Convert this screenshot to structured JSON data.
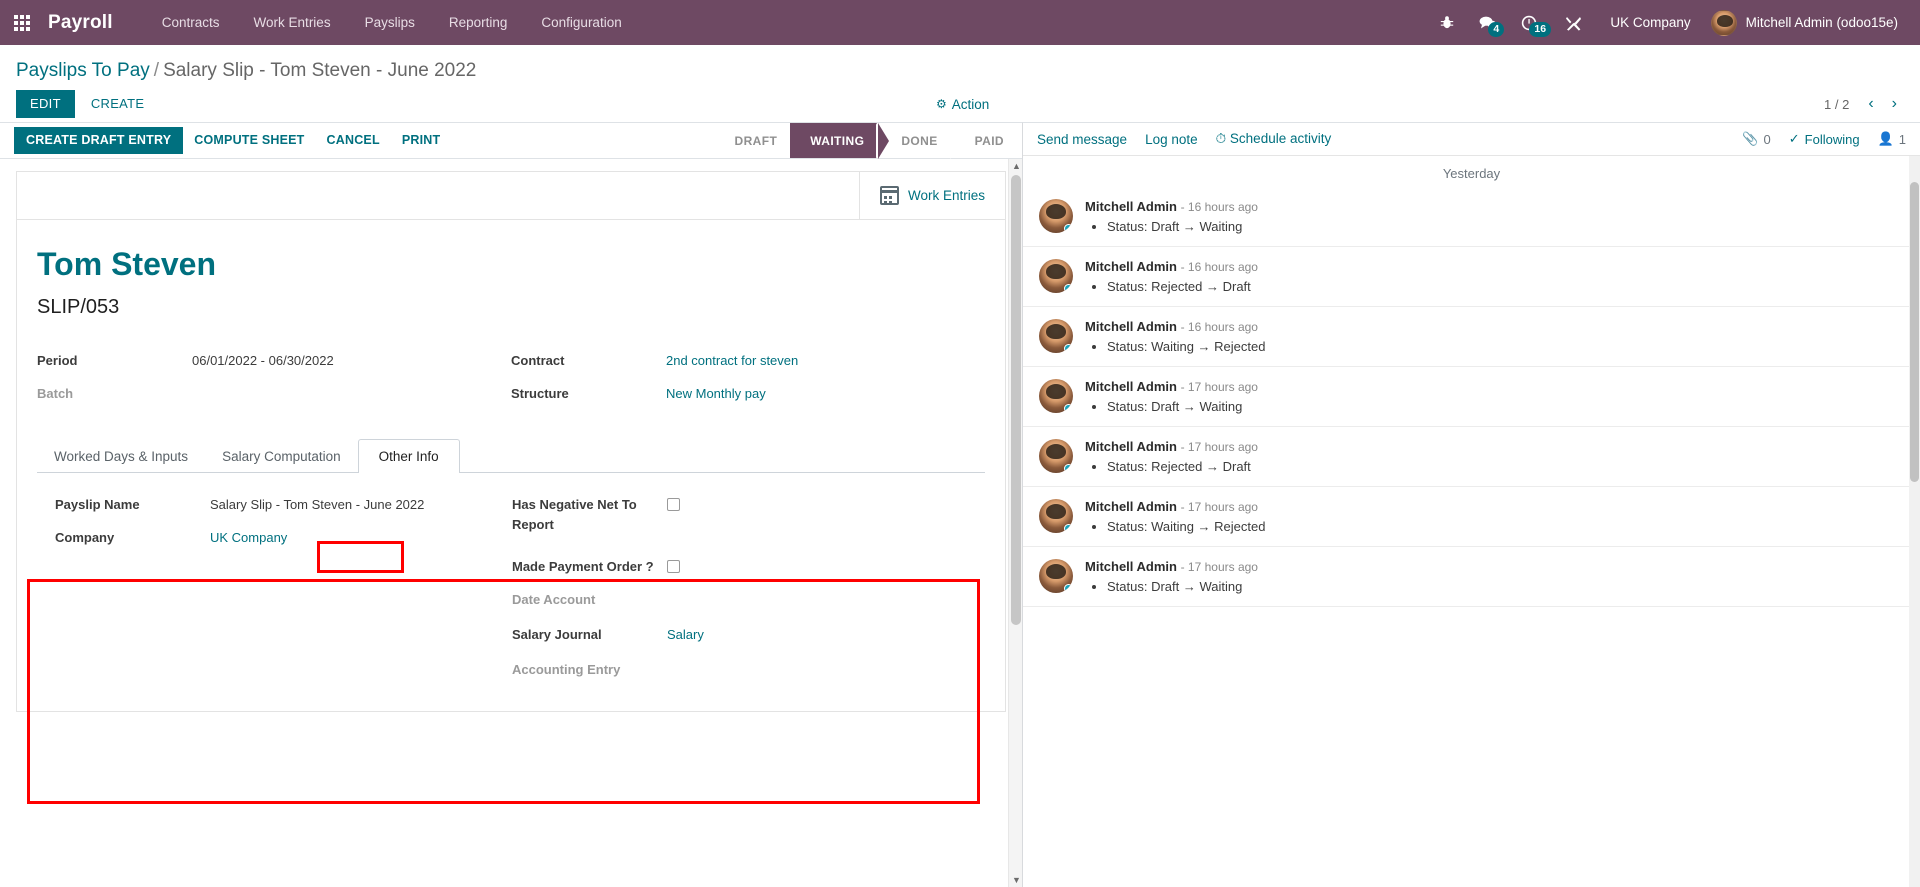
{
  "navbar": {
    "apps_icon": "apps-grid-icon",
    "brand": "Payroll",
    "menu": [
      {
        "label": "Contracts"
      },
      {
        "label": "Work Entries"
      },
      {
        "label": "Payslips"
      },
      {
        "label": "Reporting"
      },
      {
        "label": "Configuration"
      }
    ],
    "sys_icons": [
      {
        "name": "bug-icon",
        "glyph": "🐞",
        "badge": null
      },
      {
        "name": "messages-icon",
        "glyph": "💬",
        "badge": "4"
      },
      {
        "name": "activities-clock-icon",
        "glyph": "◔",
        "badge": "16"
      },
      {
        "name": "tools-icon",
        "glyph": "⚒",
        "badge": null
      }
    ],
    "company": "UK Company",
    "user": "Mitchell Admin (odoo15e)"
  },
  "breadcrumb": {
    "parent": "Payslips To Pay",
    "separator": "/",
    "current": "Salary Slip - Tom Steven - June 2022"
  },
  "control_panel": {
    "edit": "EDIT",
    "create": "CREATE",
    "action": "Action",
    "action_icon": "gear-icon",
    "pager": "1 / 2",
    "prev_icon": "‹",
    "next_icon": "›"
  },
  "statusbar_buttons": [
    {
      "label": "CREATE DRAFT ENTRY",
      "primary": true
    },
    {
      "label": "COMPUTE SHEET",
      "primary": false
    },
    {
      "label": "CANCEL",
      "primary": false
    },
    {
      "label": "PRINT",
      "primary": false
    }
  ],
  "statusbar_stages": [
    {
      "label": "DRAFT",
      "active": false
    },
    {
      "label": "WAITING",
      "active": true
    },
    {
      "label": "DONE",
      "active": false
    },
    {
      "label": "PAID",
      "active": false
    }
  ],
  "stat_buttons": [
    {
      "label": "Work Entries",
      "icon": "calendar-icon"
    }
  ],
  "record": {
    "title": "Tom Steven",
    "reference": "SLIP/053",
    "left_fields": [
      {
        "label": "Period",
        "value": "06/01/2022 - 06/30/2022",
        "type": "text",
        "muted": false
      },
      {
        "label": "Batch",
        "value": "",
        "type": "text",
        "muted": true
      }
    ],
    "right_fields": [
      {
        "label": "Contract",
        "value": "2nd contract for steven",
        "type": "link",
        "muted": false
      },
      {
        "label": "Structure",
        "value": "New Monthly pay",
        "type": "link",
        "muted": false
      }
    ]
  },
  "notebook": {
    "tabs": [
      {
        "label": "Worked Days & Inputs",
        "active": false,
        "highlighted": false
      },
      {
        "label": "Salary Computation",
        "active": false,
        "highlighted": false
      },
      {
        "label": "Other Info",
        "active": true,
        "highlighted": true
      }
    ],
    "other_info": {
      "left_fields": [
        {
          "label": "Payslip Name",
          "value": "Salary Slip - Tom Steven - June 2022",
          "type": "text",
          "muted": false
        },
        {
          "label": "Company",
          "value": "UK Company",
          "type": "link",
          "muted": false
        }
      ],
      "right_fields": [
        {
          "label": "Has Negative Net To Report",
          "value": "",
          "type": "checkbox",
          "muted": false,
          "checked": false
        },
        {
          "label": "Made Payment Order ?",
          "value": "",
          "type": "checkbox",
          "muted": false,
          "checked": false
        },
        {
          "label": "Date Account",
          "value": "",
          "type": "text",
          "muted": true
        },
        {
          "label": "Salary Journal",
          "value": "Salary",
          "type": "link",
          "muted": false
        },
        {
          "label": "Accounting Entry",
          "value": "",
          "type": "text",
          "muted": true
        }
      ]
    }
  },
  "chatter": {
    "send_message": "Send message",
    "log_note": "Log note",
    "schedule_activity": "Schedule activity",
    "schedule_icon": "clock-icon",
    "attachment_icon": "paperclip-icon",
    "attachment_count": "0",
    "following_icon": "check-icon",
    "following_label": "Following",
    "followers_icon": "user-icon",
    "followers_count": "1",
    "day_separator": "Yesterday",
    "messages": [
      {
        "author": "Mitchell Admin",
        "time": "- 16 hours ago",
        "body": "Status: Draft → Waiting"
      },
      {
        "author": "Mitchell Admin",
        "time": "- 16 hours ago",
        "body": "Status: Rejected → Draft"
      },
      {
        "author": "Mitchell Admin",
        "time": "- 16 hours ago",
        "body": "Status: Waiting → Rejected"
      },
      {
        "author": "Mitchell Admin",
        "time": "- 17 hours ago",
        "body": "Status: Draft → Waiting"
      },
      {
        "author": "Mitchell Admin",
        "time": "- 17 hours ago",
        "body": "Status: Rejected → Draft"
      },
      {
        "author": "Mitchell Admin",
        "time": "- 17 hours ago",
        "body": "Status: Waiting → Rejected"
      },
      {
        "author": "Mitchell Admin",
        "time": "- 17 hours ago",
        "body": "Status: Draft → Waiting"
      }
    ]
  },
  "colors": {
    "brand_purple": "#6e4963",
    "accent_teal": "#00707f",
    "annotation_red": "#ff0000"
  }
}
